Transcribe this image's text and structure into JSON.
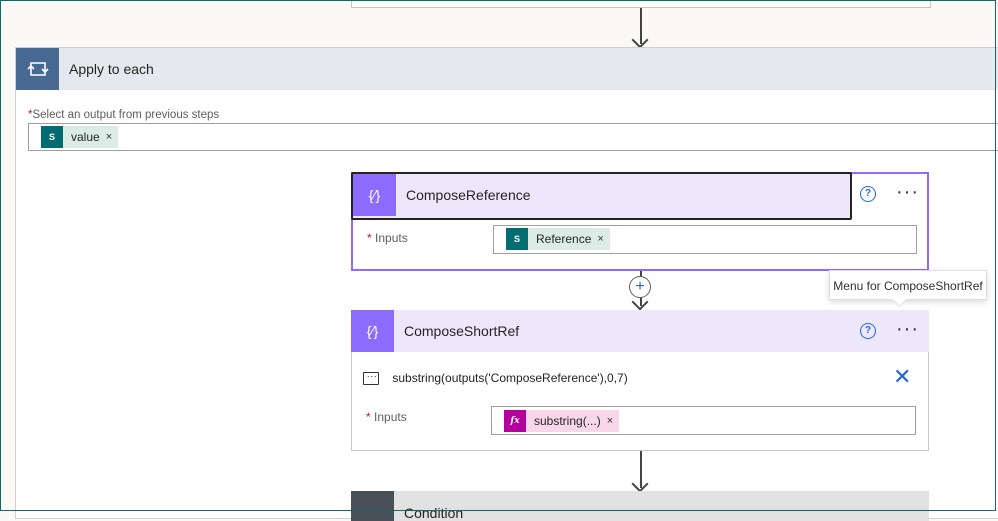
{
  "apply_to_each": {
    "title": "Apply to each",
    "required_mark": "*",
    "select_label": "Select an output from previous steps",
    "token": {
      "label": "value",
      "remove": "×",
      "icon": "sharepoint-icon"
    }
  },
  "compose_reference": {
    "title": "ComposeReference",
    "help": "?",
    "more": "···",
    "inputs_label": "Inputs",
    "required_mark": "*",
    "token": {
      "label": "Reference",
      "remove": "×",
      "icon": "sharepoint-icon"
    }
  },
  "insert_step": {
    "symbol": "+"
  },
  "tooltip": {
    "text": "Menu for ComposeShortRef"
  },
  "compose_short_ref": {
    "title": "ComposeShortRef",
    "help": "?",
    "more": "···",
    "expression": "substring(outputs('ComposeReference'),0,7)",
    "inputs_label": "Inputs",
    "required_mark": "*",
    "token": {
      "label": "substring(...)",
      "remove": "×",
      "icon": "fx-icon",
      "icon_text": "fx"
    }
  },
  "condition": {
    "title": "Condition"
  },
  "colors": {
    "loop_accent": "#486991",
    "compose_accent": "#8c6cff",
    "compose_header_bg": "#ede7fb",
    "sharepoint": "#036c70",
    "expression": "#b4009e",
    "link_blue": "#2266e3"
  }
}
